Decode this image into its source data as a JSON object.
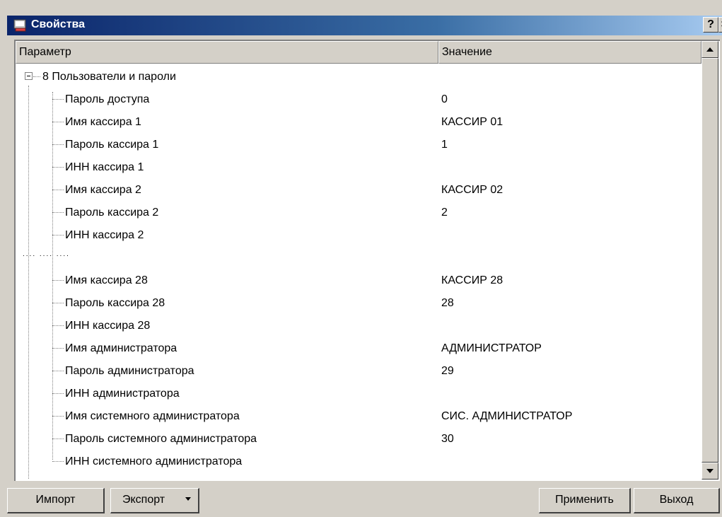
{
  "window": {
    "title": "Свойства",
    "help_label": "?",
    "close_label": "×"
  },
  "columns": {
    "param": "Параметр",
    "value": "Значение"
  },
  "group": {
    "label": "8 Пользователи и пароли"
  },
  "rows": [
    {
      "name": "Пароль доступа",
      "value": "0"
    },
    {
      "name": "Имя кассира 1",
      "value": "КАССИР 01"
    },
    {
      "name": "Пароль кассира 1",
      "value": "1"
    },
    {
      "name": "ИНН кассира 1",
      "value": ""
    },
    {
      "name": "Имя кассира 2",
      "value": "КАССИР 02"
    },
    {
      "name": "Пароль кассира 2",
      "value": "2"
    },
    {
      "name": "ИНН кассира 2",
      "value": ""
    },
    {
      "name": "Имя кассира 28",
      "value": "КАССИР 28"
    },
    {
      "name": "Пароль кассира 28",
      "value": "28"
    },
    {
      "name": "ИНН кассира 28",
      "value": ""
    },
    {
      "name": "Имя администратора",
      "value": "АДМИНИСТРАТОР"
    },
    {
      "name": "Пароль администратора",
      "value": "29"
    },
    {
      "name": "ИНН администратора",
      "value": ""
    },
    {
      "name": "Имя системного администратора",
      "value": "СИС. АДМИНИСТРАТОР"
    },
    {
      "name": "Пароль системного администратора",
      "value": "30"
    },
    {
      "name": "ИНН системного администратора",
      "value": ""
    }
  ],
  "ellipsis_row": "....   ....   ....",
  "buttons": {
    "import": "Импорт",
    "export": "Экспорт",
    "apply": "Применить",
    "exit": "Выход"
  },
  "icons": {
    "title": "window-app-icon",
    "scroll_up": "arrow-up-icon",
    "scroll_down": "arrow-down-icon",
    "export_menu": "caret-down-icon"
  },
  "colors": {
    "titlebar_start": "#0a246a",
    "titlebar_end": "#a6caf0",
    "face": "#d4d0c8"
  }
}
